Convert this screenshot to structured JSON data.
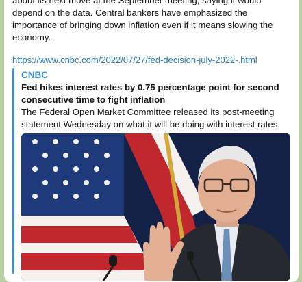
{
  "message": {
    "text": "about its next move at the September meeting, saying it would depend on the data. Central bankers have emphasized the importance of bringing down inflation even if it means slowing the economy.",
    "link": "https://www.cnbc.com/2022/07/27/fed-decision-july-2022-.html"
  },
  "preview": {
    "site_name": "CNBC",
    "title": "Fed hikes interest rates by 0.75 percentage point for second consecutive time to fight inflation",
    "description": "The Federal Open Market Committee released its post-meeting statement Wednesday on what it will be doing with interest rates.",
    "image_icon": "photo-fed-chair-flag"
  },
  "colors": {
    "background": "#b9cfa3",
    "bubble": "#ffffff",
    "link": "#2a7bb6",
    "accent": "#3a8fcc"
  }
}
